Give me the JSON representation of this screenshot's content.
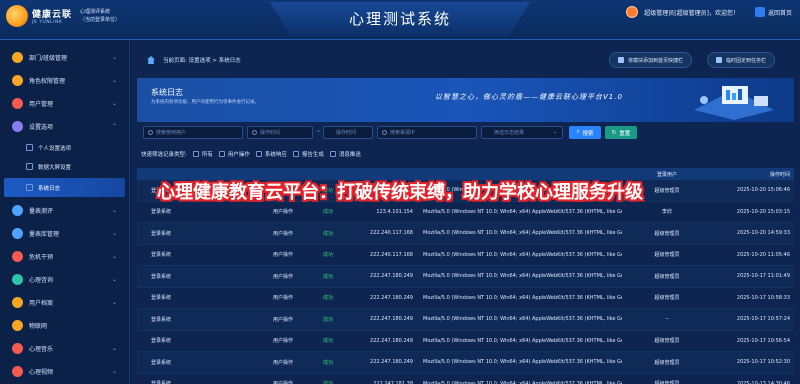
{
  "app": {
    "brand": "健康云联",
    "brand_en": "JK YUNLINK",
    "system_name": "心理测评系统",
    "unit_label": "（当前登录单位）",
    "title": "心理测试系统",
    "user": "超级管理员[超级管理员]，欢迎您！",
    "back_label": "返回首页"
  },
  "sidebar": {
    "items": [
      {
        "label": "部门/班级管理",
        "icon": "building-icon",
        "color": "#f5a623"
      },
      {
        "label": "角色权限管理",
        "icon": "shield-icon",
        "color": "#f5a623"
      },
      {
        "label": "用户管理",
        "icon": "users-icon",
        "color": "#f55a4e"
      },
      {
        "label": "设置选项",
        "icon": "gear-icon",
        "color": "#8a7cf0"
      }
    ],
    "sub_items": [
      {
        "label": "个人设置选项"
      },
      {
        "label": "数据大屏设置"
      },
      {
        "label": "系统日志"
      }
    ],
    "more_items": [
      {
        "label": "量表测评",
        "icon": "clipboard-icon",
        "color": "#4fa3ff"
      },
      {
        "label": "量表库管理",
        "icon": "database-icon",
        "color": "#4fa3ff"
      },
      {
        "label": "危机干预",
        "icon": "alert-icon",
        "color": "#f55a4e"
      },
      {
        "label": "心理咨询",
        "icon": "chat-icon",
        "color": "#2ec4a6"
      },
      {
        "label": "用户档案",
        "icon": "folder-icon",
        "color": "#f5a623"
      },
      {
        "label": "物联网",
        "icon": "iot-icon",
        "color": "#f5a623"
      },
      {
        "label": "心理音乐",
        "icon": "music-icon",
        "color": "#f55a4e"
      },
      {
        "label": "心理视频",
        "icon": "video-icon",
        "color": "#f55a4e"
      }
    ]
  },
  "breadcrumb": "当前页面: 设置选项 > 系统日志",
  "pin_buttons": [
    "将模块添加到首页快捷栏",
    "临时固定到任务栏"
  ],
  "banner": {
    "title": "系统日志",
    "subtitle": "为系统内各项功能、用户的使用行为等事件进行记录。",
    "slogan": "以智慧之心，做心灵的盾——健康云联心理平台V1.0"
  },
  "filters": {
    "user_placeholder": "搜索使用用户",
    "start_placeholder": "操作时间",
    "end_placeholder": "操作时间",
    "sep": "~",
    "ip_placeholder": "搜索来源IP",
    "type_placeholder": "筛选日志结果",
    "search_label": "搜索",
    "reset_label": "重置"
  },
  "types": {
    "label": "快速筛选记录类型:",
    "options": [
      "所有",
      "用户操作",
      "系统响应",
      "报告生成",
      "消息推送"
    ]
  },
  "table": {
    "headers": [
      "",
      "",
      "",
      "",
      "",
      "登录用户",
      "操作时间"
    ],
    "rows": [
      [
        "登录系统",
        "用户操作",
        "成功",
        "123.4.101.154",
        "Mozilla/5.0 (Windows NT 10.0; Win64; x64) AppleWebKit/537.36 (KHTML, like Gec···",
        "超级管理员",
        "2025-10-20 15:06:46"
      ],
      [
        "登录系统",
        "用户操作",
        "成功",
        "123.4.101.154",
        "Mozilla/5.0 (Windows NT 10.0; Win64; x64) AppleWebKit/537.36 (KHTML, like Gec···",
        "李欣",
        "2025-10-20 15:03:15"
      ],
      [
        "登录系统",
        "用户操作",
        "成功",
        "222.240.117.168",
        "Mozilla/5.0 (Windows NT 10.0; Win64; x64) AppleWebKit/537.36 (KHTML, like Gec···",
        "超级管理员",
        "2025-10-20 14:59:33"
      ],
      [
        "登录系统",
        "用户操作",
        "成功",
        "222.240.117.168",
        "Mozilla/5.0 (Windows NT 10.0; Win64; x64) AppleWebKit/537.36 (KHTML, like Gec···",
        "超级管理员",
        "2025-10-20 11:05:46"
      ],
      [
        "登录系统",
        "用户操作",
        "成功",
        "222.247.180.249",
        "Mozilla/5.0 (Windows NT 10.0; Win64; x64) AppleWebKit/537.36 (KHTML, like Gec···",
        "超级管理员",
        "2025-10-17 11:01:49"
      ],
      [
        "登录系统",
        "用户操作",
        "成功",
        "222.247.180.249",
        "Mozilla/5.0 (Windows NT 10.0; Win64; x64) AppleWebKit/537.36 (KHTML, like Gec···",
        "超级管理员",
        "2025-10-17 10:58:33"
      ],
      [
        "登录系统",
        "用户操作",
        "成功",
        "222.247.180.249",
        "Mozilla/5.0 (Windows NT 10.0; Win64; x64) AppleWebKit/537.36 (KHTML, like Gec···",
        "--",
        "2025-10-17 10:57:24"
      ],
      [
        "登录系统",
        "用户操作",
        "成功",
        "222.247.180.249",
        "Mozilla/5.0 (Windows NT 10.0; Win64; x64) AppleWebKit/537.36 (KHTML, like Gec···",
        "超级管理员",
        "2025-10-17 10:56:54"
      ],
      [
        "登录系统",
        "用户操作",
        "成功",
        "222.247.180.249",
        "Mozilla/5.0 (Windows NT 10.0; Win64; x64) AppleWebKit/537.36 (KHTML, like Gec···",
        "超级管理员",
        "2025-10-17 10:52:30"
      ],
      [
        "登录系统",
        "用户操作",
        "成功",
        "222.247.181.38",
        "Mozilla/5.0 (Windows NT 10.0; Win64; x64) AppleWebKit/537.36 (KHTML, like Gec···",
        "超级管理员",
        "2025-10-13 14:30:46"
      ]
    ]
  },
  "overlay_caption": "心理健康教育云平台：打破传统束缚，助力学校心理服务升级"
}
